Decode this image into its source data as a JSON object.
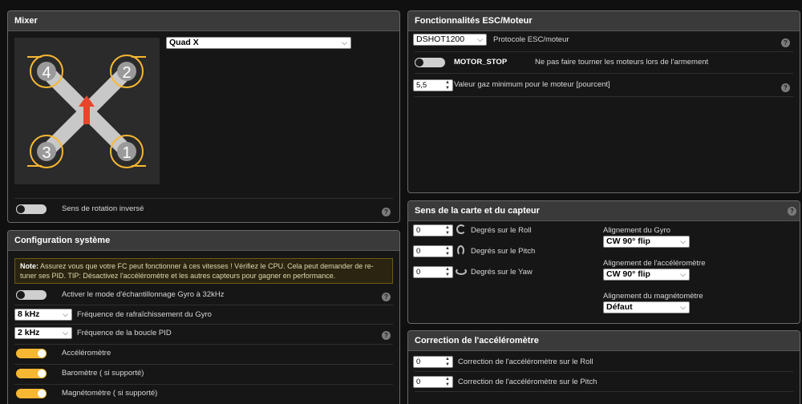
{
  "mixer": {
    "title": "Mixer",
    "model": "Quad X",
    "motors": [
      "1",
      "2",
      "3",
      "4"
    ],
    "reverse_label": "Sens de rotation inversé",
    "reverse_on": false
  },
  "system": {
    "title": "Configuration système",
    "note_strong": "Note:",
    "note_text": " Assurez vous que votre FC peut fonctionner à ces vitesses ! Vérifiez le CPU. Cela peut demander de re-tuner ses PID. TIP: Désactivez l'accéléromètre et les autres capteurs pour gagner en performance.",
    "gyro32_label": "Activer le mode d'échantillonnage Gyro à 32kHz",
    "gyro_freq": "8 kHz",
    "gyro_freq_label": "Fréquence de rafraîchissement du Gyro",
    "pid_freq": "2 kHz",
    "pid_freq_label": "Fréquence de la boucle PID",
    "acc_label": "Accéléromètre",
    "baro_label": "Baromètre ( si supporté)",
    "mag_label": "Magnétomètre ( si supporté)"
  },
  "esc": {
    "title": "Fonctionnalités ESC/Moteur",
    "protocol": "DSHOT1200",
    "protocol_label": "Protocole ESC/moteur",
    "motor_stop": "MOTOR_STOP",
    "motor_stop_desc": "Ne pas faire tourner les moteurs lors de l'armement",
    "min_throttle": "5,5",
    "min_throttle_label": "Valeur gaz minimum pour le moteur [pourcent]"
  },
  "board": {
    "title": "Sens de la carte et du capteur",
    "roll": "0",
    "roll_label": "Degrés sur le Roll",
    "pitch": "0",
    "pitch_label": "Degrés sur le Pitch",
    "yaw": "0",
    "yaw_label": "Degrés sur le Yaw",
    "gyro_align_label": "Alignement du Gyro",
    "gyro_align": "CW 90° flip",
    "acc_align_label": "Alignement de l'accéléromètre",
    "acc_align": "CW 90° flip",
    "mag_align_label": "Alignement du magnétomètre",
    "mag_align": "Défaut"
  },
  "acc_trim": {
    "title": "Correction de l'accéléromètre",
    "roll": "0",
    "roll_label": "Correction de l'accéléromètre sur le Roll",
    "pitch": "0",
    "pitch_label": "Correction de l'accéléromètre sur le Pitch"
  },
  "icons": {
    "help": "?",
    "chevron": "⌵",
    "spin": "▲▼"
  },
  "colors": {
    "accent": "#f7b733",
    "arrow": "#e8452c",
    "arm": "#c8c8c8"
  }
}
